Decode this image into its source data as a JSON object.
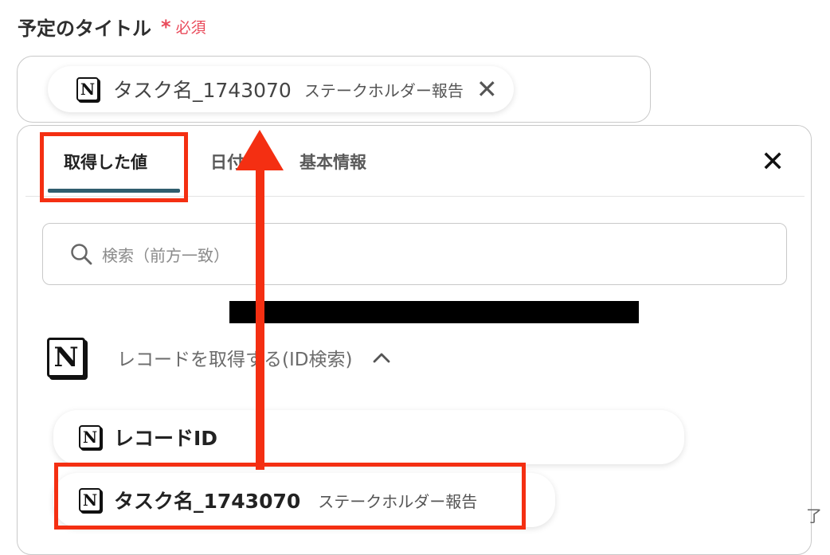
{
  "field": {
    "label": "予定のタイトル",
    "required_mark": "*",
    "required_text": "必須"
  },
  "title_chip": {
    "icon": "notion-icon",
    "name": "タスク名_1743070",
    "sub": "ステークホルダー報告",
    "close": "✕"
  },
  "tabs": [
    {
      "label": "取得した値",
      "active": true
    },
    {
      "label": "日付",
      "active": false
    },
    {
      "label": "基本情報",
      "active": false
    }
  ],
  "panel_close": "✕",
  "search": {
    "placeholder": "検索（前方一致）"
  },
  "section": {
    "icon": "notion-icon",
    "title": "レコードを取得する(ID検索)",
    "chevron": "chevron-up-icon"
  },
  "rows": [
    {
      "icon": "notion-icon",
      "name": "レコードID",
      "sub": ""
    },
    {
      "icon": "notion-icon",
      "name": "タスク名_1743070",
      "sub": "ステークホルダー報告"
    }
  ],
  "edge_text": "了",
  "colors": {
    "required": "#e94b5b",
    "tab_underline": "#2f5d6e",
    "highlight": "#f42f12"
  }
}
